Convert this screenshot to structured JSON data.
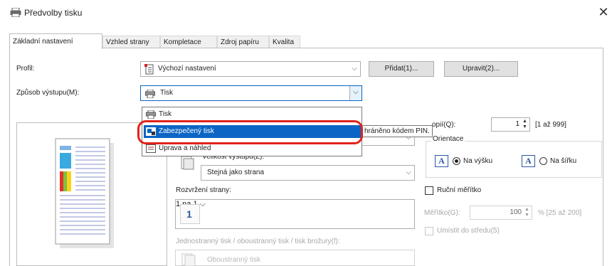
{
  "window": {
    "title": "Předvolby tisku",
    "close_label": "✕"
  },
  "tabs": [
    {
      "label": "Základní nastavení",
      "active": true
    },
    {
      "label": "Vzhled strany",
      "active": false
    },
    {
      "label": "Kompletace",
      "active": false
    },
    {
      "label": "Zdroj papíru",
      "active": false
    },
    {
      "label": "Kvalita",
      "active": false
    }
  ],
  "profile": {
    "label": "Profil:",
    "value": "Výchozí nastavení",
    "add_button": "Přidat(1)...",
    "edit_button": "Upravit(2)..."
  },
  "output": {
    "label": "Způsob výstupu(M):",
    "value": "Tisk",
    "options": [
      {
        "label": "Tisk",
        "icon": "printer-icon",
        "selected": false
      },
      {
        "label": "Zabezpečený tisk",
        "icon": "secure-print-icon",
        "selected": true
      },
      {
        "label": "Úprava a náhled",
        "icon": "edit-preview-icon",
        "selected": false
      }
    ]
  },
  "tooltip": "hráněno kódem PIN.",
  "copies": {
    "label": "opií(Q):",
    "value": "1",
    "range": "[1 až 999]"
  },
  "orientation": {
    "label": "Orientace",
    "portrait_label": "Na výšku",
    "landscape_label": "Na šířku",
    "selected": "portrait"
  },
  "output_size": {
    "label": "Velikost výstupu(Z):",
    "value": "Stejná jako strana"
  },
  "page_layout": {
    "label": "Rozvržení strany:",
    "value": "1 na 1",
    "icon_number": "1"
  },
  "manual_scaling": {
    "label": "Ruční měřítko",
    "checked": false,
    "scale_label": "Měřítko(G):",
    "scale_value": "100",
    "scale_range": "% [25 až 200]",
    "center_label": "Umístit do středu(5)"
  },
  "print_mode": {
    "label": "Jednostranný tisk / oboustranný tisk / tisk brožury(f):",
    "value": "Oboustranný tisk"
  },
  "colors": {
    "accent": "#0b65c4",
    "highlight_ring": "#e0231c"
  }
}
